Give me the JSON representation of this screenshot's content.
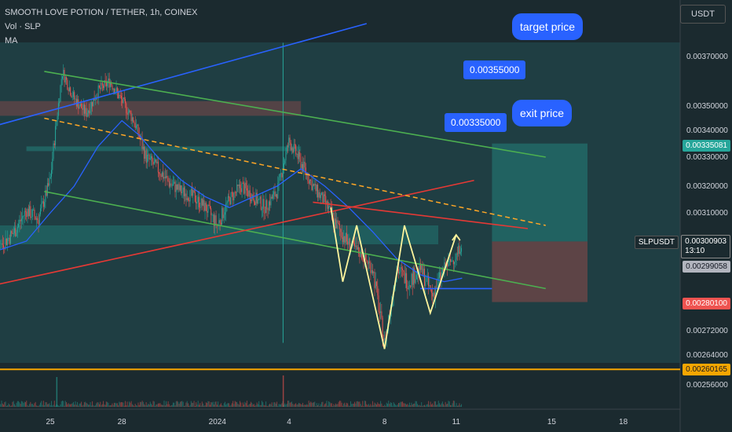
{
  "header": {
    "symbol_line": "SMOOTH LOVE POTION / TETHER, 1h, COINEX",
    "vol_line": "Vol · SLP",
    "ma_line": "MA"
  },
  "currency_button": "USDT",
  "annotations": {
    "target_price": "target price",
    "exit_price": "exit price",
    "level_target": "0.00355000",
    "level_exit": "0.00335000"
  },
  "price_tags": {
    "tp": {
      "value": "0.00335081",
      "color": "#26a69a"
    },
    "symbol": "SLPUSDT",
    "current": {
      "value": "0.00300903",
      "sub": "13:10",
      "color": "#1b2a2f"
    },
    "ma": {
      "value": "0.00299058",
      "color": "#b2b5be"
    },
    "sl": {
      "value": "0.00280100",
      "color": "#ef5350"
    },
    "base": {
      "value": "0.00260165",
      "color": "#f7a600"
    }
  },
  "chart_data": {
    "type": "candlestick",
    "y_ticks": [
      0.0037,
      0.0035,
      0.0034,
      0.0033,
      0.0032,
      0.0031,
      0.00272,
      0.00264,
      0.00256
    ],
    "y_tick_labels": [
      "0.00370000",
      "0.00350000",
      "0.00340000",
      "0.00330000",
      "0.00320000",
      "0.00310000",
      "0.00272000",
      "0.00264000",
      "0.00256000"
    ],
    "x_ticks": [
      "25",
      "28",
      "2024",
      "4",
      "8",
      "11",
      "15",
      "18"
    ],
    "x_tick_dates": [
      "2023-12-25",
      "2023-12-28",
      "2024-01-01",
      "2024-01-04",
      "2024-01-08",
      "2024-01-11",
      "2024-01-15",
      "2024-01-18"
    ],
    "ylim": [
      0.00252,
      0.00382
    ],
    "legend": "none",
    "grid": false,
    "price_path": [
      [
        "2023-12-22T00:00",
        0.00294
      ],
      [
        "2023-12-22T12:00",
        0.00298
      ],
      [
        "2023-12-23T00:00",
        0.003
      ],
      [
        "2023-12-23T12:00",
        0.00304
      ],
      [
        "2023-12-24T00:00",
        0.00311
      ],
      [
        "2023-12-24T12:00",
        0.00308
      ],
      [
        "2023-12-25T00:00",
        0.00322
      ],
      [
        "2023-12-25T12:00",
        0.00364
      ],
      [
        "2023-12-26T00:00",
        0.00353
      ],
      [
        "2023-12-26T12:00",
        0.00347
      ],
      [
        "2023-12-27T00:00",
        0.00356
      ],
      [
        "2023-12-27T12:00",
        0.0036
      ],
      [
        "2023-12-28T00:00",
        0.00352
      ],
      [
        "2023-12-28T12:00",
        0.00344
      ],
      [
        "2023-12-29T00:00",
        0.0033
      ],
      [
        "2023-12-29T12:00",
        0.00326
      ],
      [
        "2023-12-30T00:00",
        0.00321
      ],
      [
        "2023-12-30T12:00",
        0.00318
      ],
      [
        "2023-12-31T00:00",
        0.00316
      ],
      [
        "2023-12-31T12:00",
        0.00312
      ],
      [
        "2024-01-01T00:00",
        0.00306
      ],
      [
        "2024-01-01T12:00",
        0.00315
      ],
      [
        "2024-01-02T00:00",
        0.0032
      ],
      [
        "2024-01-02T12:00",
        0.00316
      ],
      [
        "2024-01-03T00:00",
        0.00312
      ],
      [
        "2024-01-03T12:00",
        0.00318
      ],
      [
        "2024-01-04T00:00",
        0.00336
      ],
      [
        "2024-01-04T12:00",
        0.00328
      ],
      [
        "2024-01-05T00:00",
        0.0032
      ],
      [
        "2024-01-05T12:00",
        0.00314
      ],
      [
        "2024-01-06T00:00",
        0.00306
      ],
      [
        "2024-01-06T12:00",
        0.003
      ],
      [
        "2024-01-07T00:00",
        0.00296
      ],
      [
        "2024-01-07T12:00",
        0.0029
      ],
      [
        "2024-01-08T00:00",
        0.00268
      ],
      [
        "2024-01-08T12:00",
        0.0029
      ],
      [
        "2024-01-09T00:00",
        0.00286
      ],
      [
        "2024-01-09T12:00",
        0.0029
      ],
      [
        "2024-01-10T00:00",
        0.00282
      ],
      [
        "2024-01-10T12:00",
        0.0029
      ],
      [
        "2024-01-11T00:00",
        0.00295
      ],
      [
        "2024-01-11T06:00",
        0.00301
      ]
    ],
    "moving_average": [
      [
        "2023-12-22T00:00",
        0.00295
      ],
      [
        "2023-12-23T00:00",
        0.00298
      ],
      [
        "2023-12-24T00:00",
        0.00301
      ],
      [
        "2023-12-25T00:00",
        0.0031
      ],
      [
        "2023-12-26T00:00",
        0.0032
      ],
      [
        "2023-12-27T00:00",
        0.00334
      ],
      [
        "2023-12-28T00:00",
        0.00344
      ],
      [
        "2023-12-28T18:00",
        0.00338
      ],
      [
        "2023-12-29T12:00",
        0.0033
      ],
      [
        "2023-12-30T12:00",
        0.00322
      ],
      [
        "2023-12-31T12:00",
        0.00316
      ],
      [
        "2024-01-01T12:00",
        0.00312
      ],
      [
        "2024-01-02T12:00",
        0.00316
      ],
      [
        "2024-01-03T12:00",
        0.0032
      ],
      [
        "2024-01-04T12:00",
        0.00326
      ],
      [
        "2024-01-05T12:00",
        0.0032
      ],
      [
        "2024-01-06T12:00",
        0.00312
      ],
      [
        "2024-01-07T12:00",
        0.00304
      ],
      [
        "2024-01-08T12:00",
        0.00294
      ],
      [
        "2024-01-09T12:00",
        0.00288
      ],
      [
        "2024-01-10T12:00",
        0.00286
      ],
      [
        "2024-01-11T06:00",
        0.00287
      ]
    ],
    "zigzag_pattern": [
      [
        "2024-01-05T18:00",
        0.00312
      ],
      [
        "2024-01-06T06:00",
        0.00286
      ],
      [
        "2024-01-06T20:00",
        0.00306
      ],
      [
        "2024-01-08T00:00",
        0.00266
      ],
      [
        "2024-01-08T20:00",
        0.00306
      ],
      [
        "2024-01-09T22:00",
        0.00277
      ],
      [
        "2024-01-11T00:00",
        0.00303
      ]
    ],
    "trendlines": [
      {
        "color": "#2962ff",
        "from": [
          "2023-12-22T00:00",
          0.0034
        ],
        "to": [
          "2024-01-07T06:00",
          0.00382
        ]
      },
      {
        "color": "#4caf50",
        "from": [
          "2023-12-24T18:00",
          0.00364
        ],
        "to": [
          "2024-01-14T18:00",
          0.0033
        ]
      },
      {
        "color": "#4caf50",
        "from": [
          "2023-12-24T18:00",
          0.00318
        ],
        "to": [
          "2024-01-14T18:00",
          0.00284
        ]
      },
      {
        "color": "#e53935",
        "from": [
          "2023-12-22T00:00",
          0.00284
        ],
        "to": [
          "2024-01-11T18:00",
          0.00322
        ]
      },
      {
        "color": "#e53935",
        "from": [
          "2024-01-05T00:00",
          0.00314
        ],
        "to": [
          "2024-01-14T00:00",
          0.00305
        ]
      },
      {
        "color": "#ffa726",
        "dashed": true,
        "from": [
          "2023-12-24T18:00",
          0.00345
        ],
        "to": [
          "2024-01-14T18:00",
          0.00306
        ]
      },
      {
        "color": "#2962ff",
        "from": [
          "2024-01-09T12:00",
          0.00284
        ],
        "to": [
          "2024-01-12T12:00",
          0.00284
        ]
      }
    ],
    "zones": [
      {
        "color": "#ef5350",
        "opacity": 0.25,
        "from": [
          "2023-12-22T00:00",
          0.00352
        ],
        "to": [
          "2024-01-04T12:00",
          0.00346
        ]
      },
      {
        "color": "#26a69a",
        "opacity": 0.35,
        "from": [
          "2023-12-24T00:00",
          0.00334
        ],
        "to": [
          "2024-01-04T12:00",
          0.00333
        ]
      },
      {
        "color": "#26a69a",
        "opacity": 0.3,
        "from": [
          "2023-12-22T00:00",
          0.00306
        ],
        "to": [
          "2024-01-10T06:00",
          0.003
        ]
      },
      {
        "color": "#26a69a",
        "opacity": 0.35,
        "from": [
          "2024-01-12T12:00",
          0.00335081
        ],
        "to": [
          "2024-01-16T12:00",
          0.00300903
        ]
      },
      {
        "color": "#ef5350",
        "opacity": 0.3,
        "from": [
          "2024-01-12T12:00",
          0.00300903
        ],
        "to": [
          "2024-01-16T12:00",
          0.002801
        ]
      }
    ],
    "horizontal_levels": [
      {
        "price": 0.00260165,
        "color": "#f7a600"
      }
    ]
  }
}
